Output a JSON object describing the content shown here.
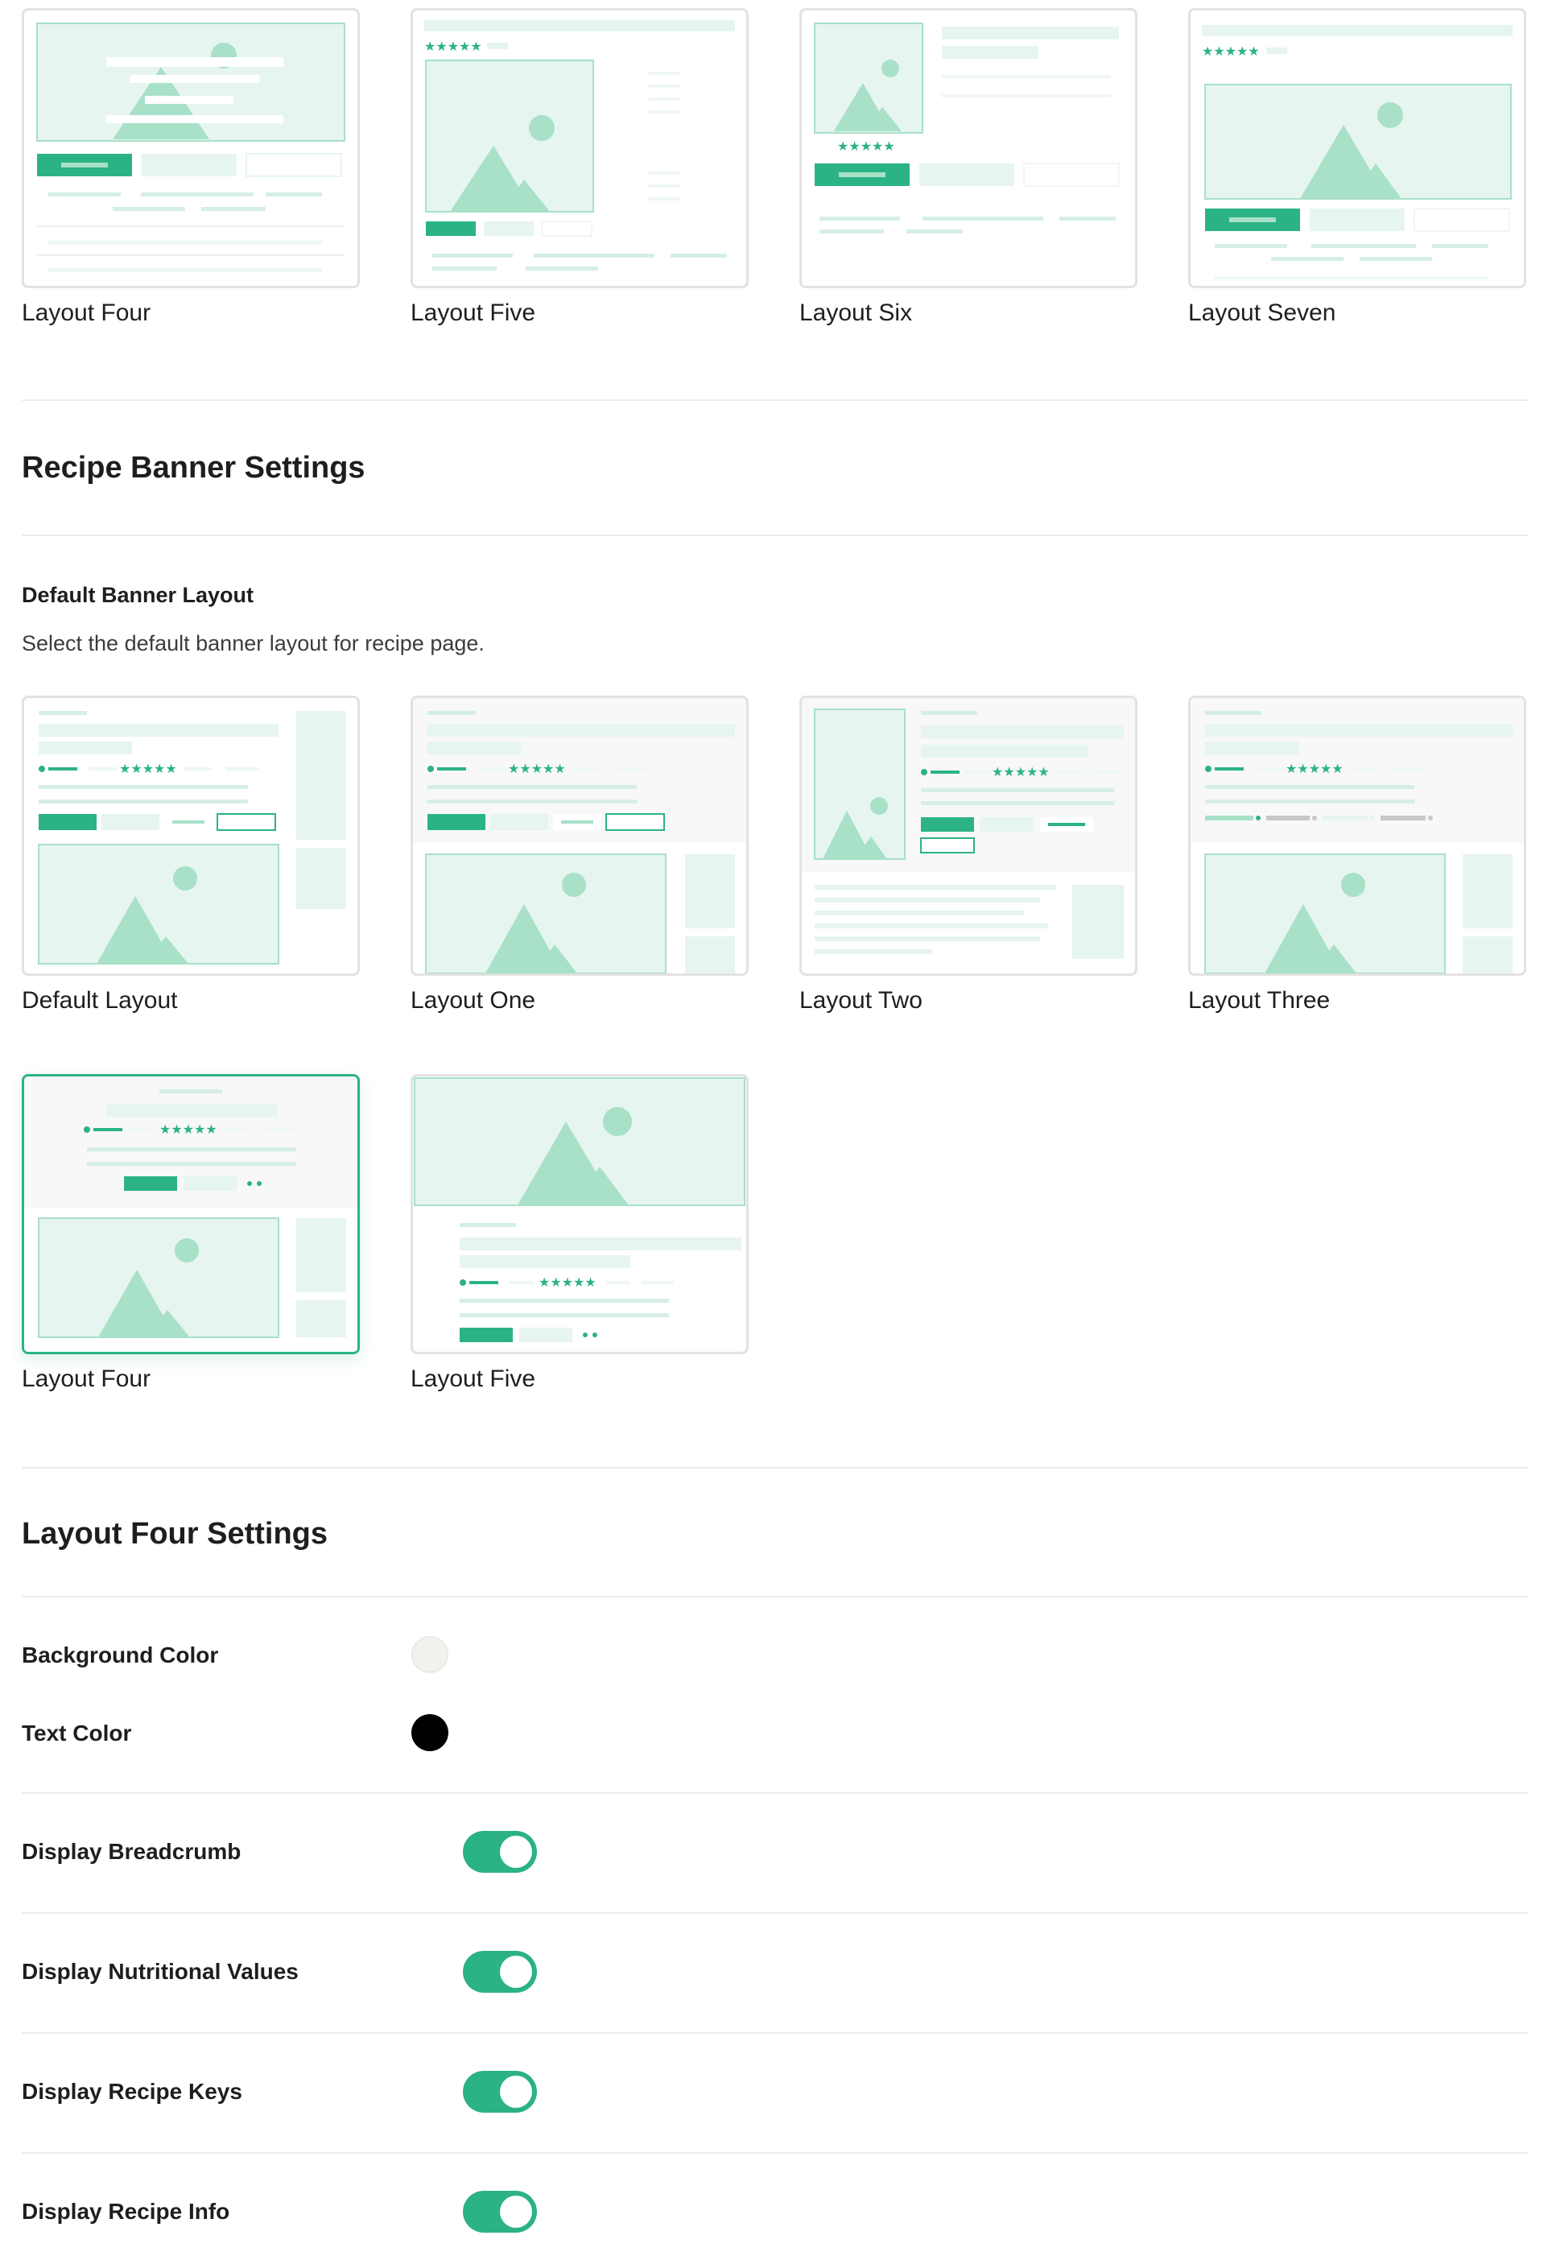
{
  "top_layouts": [
    {
      "label": "Layout Four"
    },
    {
      "label": "Layout Five"
    },
    {
      "label": "Layout Six"
    },
    {
      "label": "Layout Seven"
    }
  ],
  "banner_section": {
    "title": "Recipe Banner Settings",
    "field_title": "Default Banner Layout",
    "field_desc": "Select the default banner layout for recipe page.",
    "layouts": [
      {
        "label": "Default Layout"
      },
      {
        "label": "Layout One"
      },
      {
        "label": "Layout Two"
      },
      {
        "label": "Layout Three"
      },
      {
        "label": "Layout Four",
        "selected": true
      },
      {
        "label": "Layout Five"
      }
    ]
  },
  "layout_four_settings": {
    "title": "Layout Four Settings",
    "background_color_label": "Background Color",
    "background_color": "#f3f1ee",
    "text_color_label": "Text Color",
    "text_color": "#000000",
    "toggles": [
      {
        "label": "Display Breadcrumb",
        "on": true
      },
      {
        "label": "Display Nutritional Values",
        "on": true
      },
      {
        "label": "Display Recipe Keys",
        "on": true
      },
      {
        "label": "Display Recipe Info",
        "on": true
      }
    ]
  },
  "colors": {
    "accent": "#2bb386",
    "light_accent": "#e6f5ef",
    "mid_accent": "#a8e0c8",
    "border": "#e2e2e2"
  }
}
